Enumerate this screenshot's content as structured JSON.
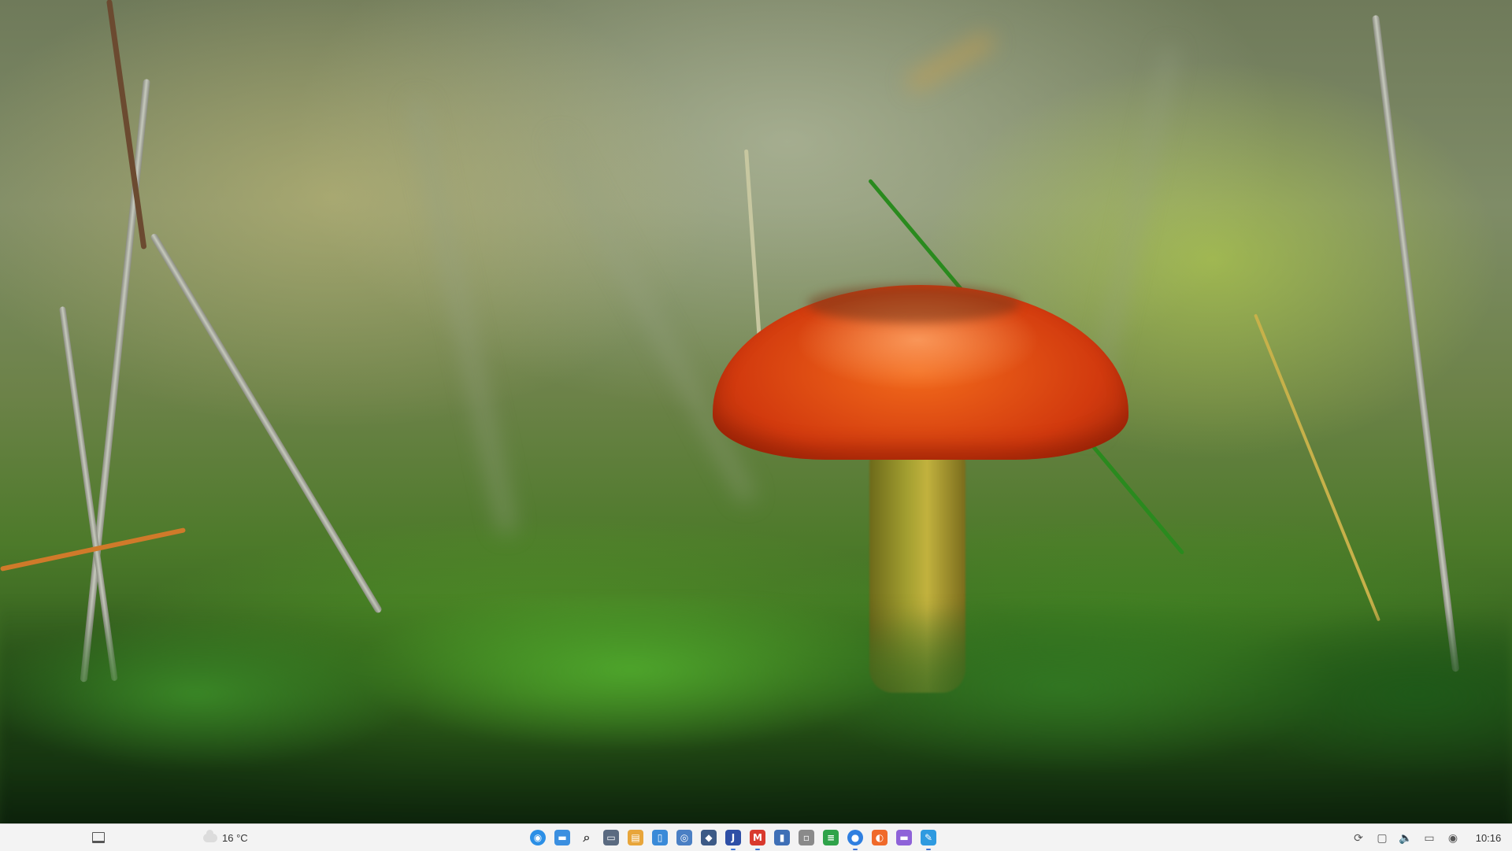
{
  "wallpaper": {
    "subject": "",
    "accent": "#e0521a"
  },
  "taskbar": {
    "background": "#f3f3f3",
    "show_desktop_icon": "show-desktop-icon",
    "weather": {
      "text": "16 °C",
      "icon": "cloud-icon"
    },
    "pinned_apps": [
      {
        "name": "launcher",
        "icon": "launcher-icon",
        "color": "#2b8fe6",
        "glyph": "◉",
        "running": false
      },
      {
        "name": "file-manager",
        "icon": "folder-icon",
        "color": "#3b8fe0",
        "glyph": "▬",
        "running": false
      },
      {
        "name": "search",
        "icon": "search-icon",
        "color": "#f3f3f3",
        "glyph": "⌕",
        "running": false
      },
      {
        "name": "terminal",
        "icon": "terminal-icon",
        "color": "#5a6a80",
        "glyph": "▭",
        "running": false
      },
      {
        "name": "files",
        "icon": "files-icon",
        "color": "#e8a53a",
        "glyph": "▤",
        "running": false
      },
      {
        "name": "device",
        "icon": "phone-icon",
        "color": "#3a8ad8",
        "glyph": "▯",
        "running": false
      },
      {
        "name": "screenshot",
        "icon": "camera-icon",
        "color": "#4a7fc4",
        "glyph": "◎",
        "running": false
      },
      {
        "name": "remote",
        "icon": "car-icon",
        "color": "#3c5a86",
        "glyph": "◆",
        "running": false
      },
      {
        "name": "j-app",
        "icon": "j-icon",
        "color": "#2e4fa6",
        "glyph": "J",
        "running": true
      },
      {
        "name": "m-app",
        "icon": "m-icon",
        "color": "#d93a2e",
        "glyph": "M",
        "running": true
      },
      {
        "name": "book",
        "icon": "book-icon",
        "color": "#3e6fb6",
        "glyph": "▮",
        "running": false
      },
      {
        "name": "notes",
        "icon": "notes-icon",
        "color": "#8a8a8a",
        "glyph": "▫",
        "running": false
      },
      {
        "name": "layers",
        "icon": "layers-icon",
        "color": "#2fa34a",
        "glyph": "≡",
        "running": false
      },
      {
        "name": "circle-app",
        "icon": "circle-icon",
        "color": "#2f7fe0",
        "glyph": "●",
        "running": true
      },
      {
        "name": "browser",
        "icon": "firefox-icon",
        "color": "#f06a2a",
        "glyph": "◐",
        "running": false
      },
      {
        "name": "folder",
        "icon": "purple-folder-icon",
        "color": "#8e62d8",
        "glyph": "▬",
        "running": false
      },
      {
        "name": "editor",
        "icon": "editor-icon",
        "color": "#2e9ae0",
        "glyph": "✎",
        "running": true
      }
    ],
    "tray": [
      {
        "name": "sync",
        "icon": "sync-icon",
        "glyph": "⟳"
      },
      {
        "name": "clipboard",
        "icon": "clipboard-icon",
        "glyph": "▢"
      },
      {
        "name": "volume",
        "icon": "volume-icon",
        "glyph": "🔈"
      },
      {
        "name": "display",
        "icon": "display-icon",
        "glyph": "▭"
      },
      {
        "name": "network",
        "icon": "network-icon",
        "glyph": "◉"
      }
    ],
    "clock": "10:16"
  }
}
